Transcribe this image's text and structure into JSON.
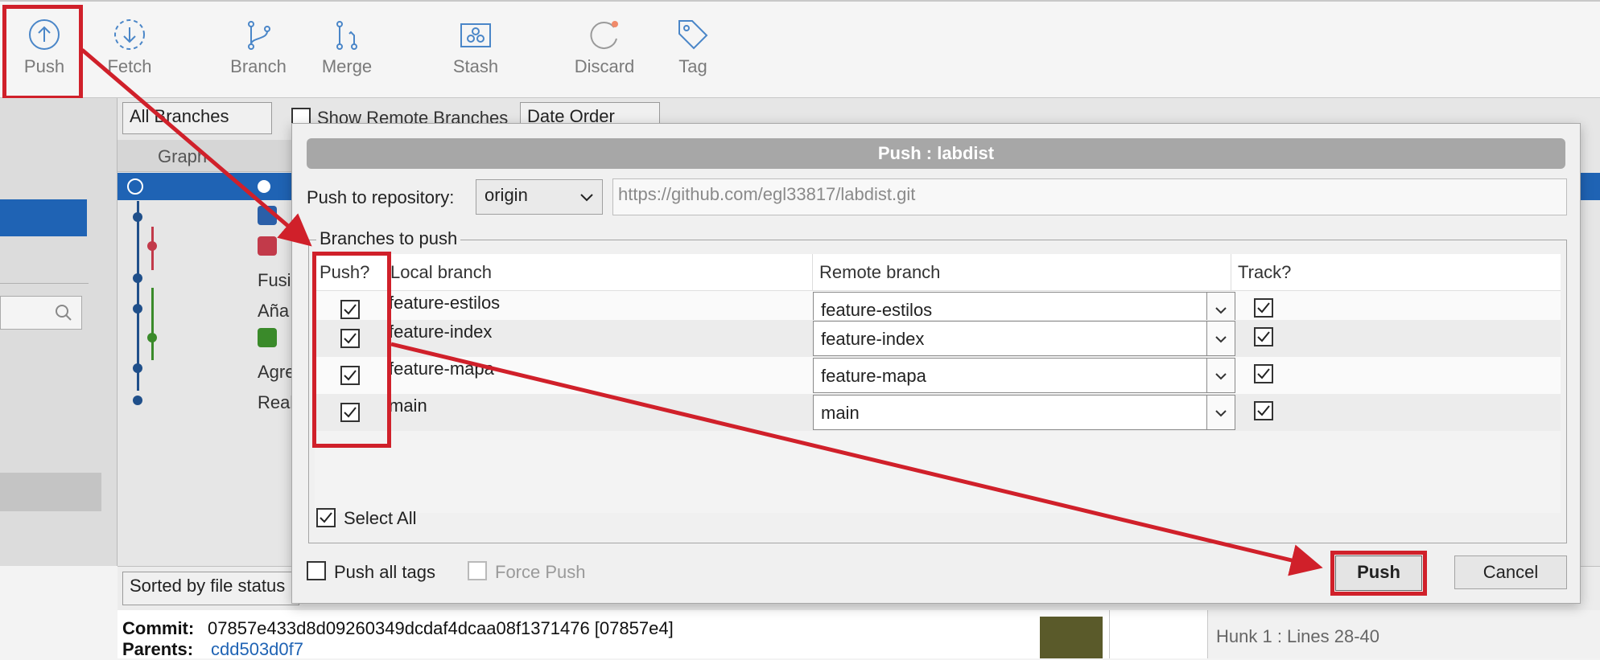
{
  "toolbar": {
    "items": [
      {
        "label": "Push",
        "icon": "push-icon"
      },
      {
        "label": "Fetch",
        "icon": "fetch-icon"
      },
      {
        "label": "Branch",
        "icon": "branch-icon"
      },
      {
        "label": "Merge",
        "icon": "merge-icon"
      },
      {
        "label": "Stash",
        "icon": "stash-icon"
      },
      {
        "label": "Discard",
        "icon": "discard-icon"
      },
      {
        "label": "Tag",
        "icon": "tag-icon"
      }
    ]
  },
  "filter": {
    "branches": "All Branches",
    "show_remote": "Show Remote Branches",
    "order": "Date Order"
  },
  "graph": {
    "column": "Graph",
    "rows": [
      "Fusi",
      "Aña",
      "Agre",
      "Real"
    ]
  },
  "dialog": {
    "title": "Push :  labdist",
    "repo_label": "Push to repository:",
    "repo_value": "origin",
    "repo_url": "https://github.com/egl33817/labdist.git",
    "group_title": "Branches to push",
    "headers": {
      "push": "Push?",
      "local": "Local branch",
      "remote": "Remote branch",
      "track": "Track?"
    },
    "rows": [
      {
        "local": "feature-estilos",
        "remote": "feature-estilos",
        "push": true,
        "track": true
      },
      {
        "local": "feature-index",
        "remote": "feature-index",
        "push": true,
        "track": true
      },
      {
        "local": "feature-mapa",
        "remote": "feature-mapa",
        "push": true,
        "track": true
      },
      {
        "local": "main",
        "remote": "main",
        "push": true,
        "track": true
      }
    ],
    "select_all": "Select All",
    "push_all_tags": "Push all tags",
    "force_push": "Force Push",
    "push_button": "Push",
    "cancel_button": "Cancel"
  },
  "bottom": {
    "sort": "Sorted by file status",
    "commit_label": "Commit:",
    "commit_value": "07857e433d8d09260349dcdaf4dcaa08f1371476 [07857e4]",
    "parents_label": "Parents:",
    "parents_value": "cdd503d0f7",
    "hunk": "Hunk 1 : Lines 28-40"
  },
  "colors": {
    "annotation": "#d0202a",
    "selection": "#1f63b4",
    "icon_blue": "#4a86c8"
  }
}
